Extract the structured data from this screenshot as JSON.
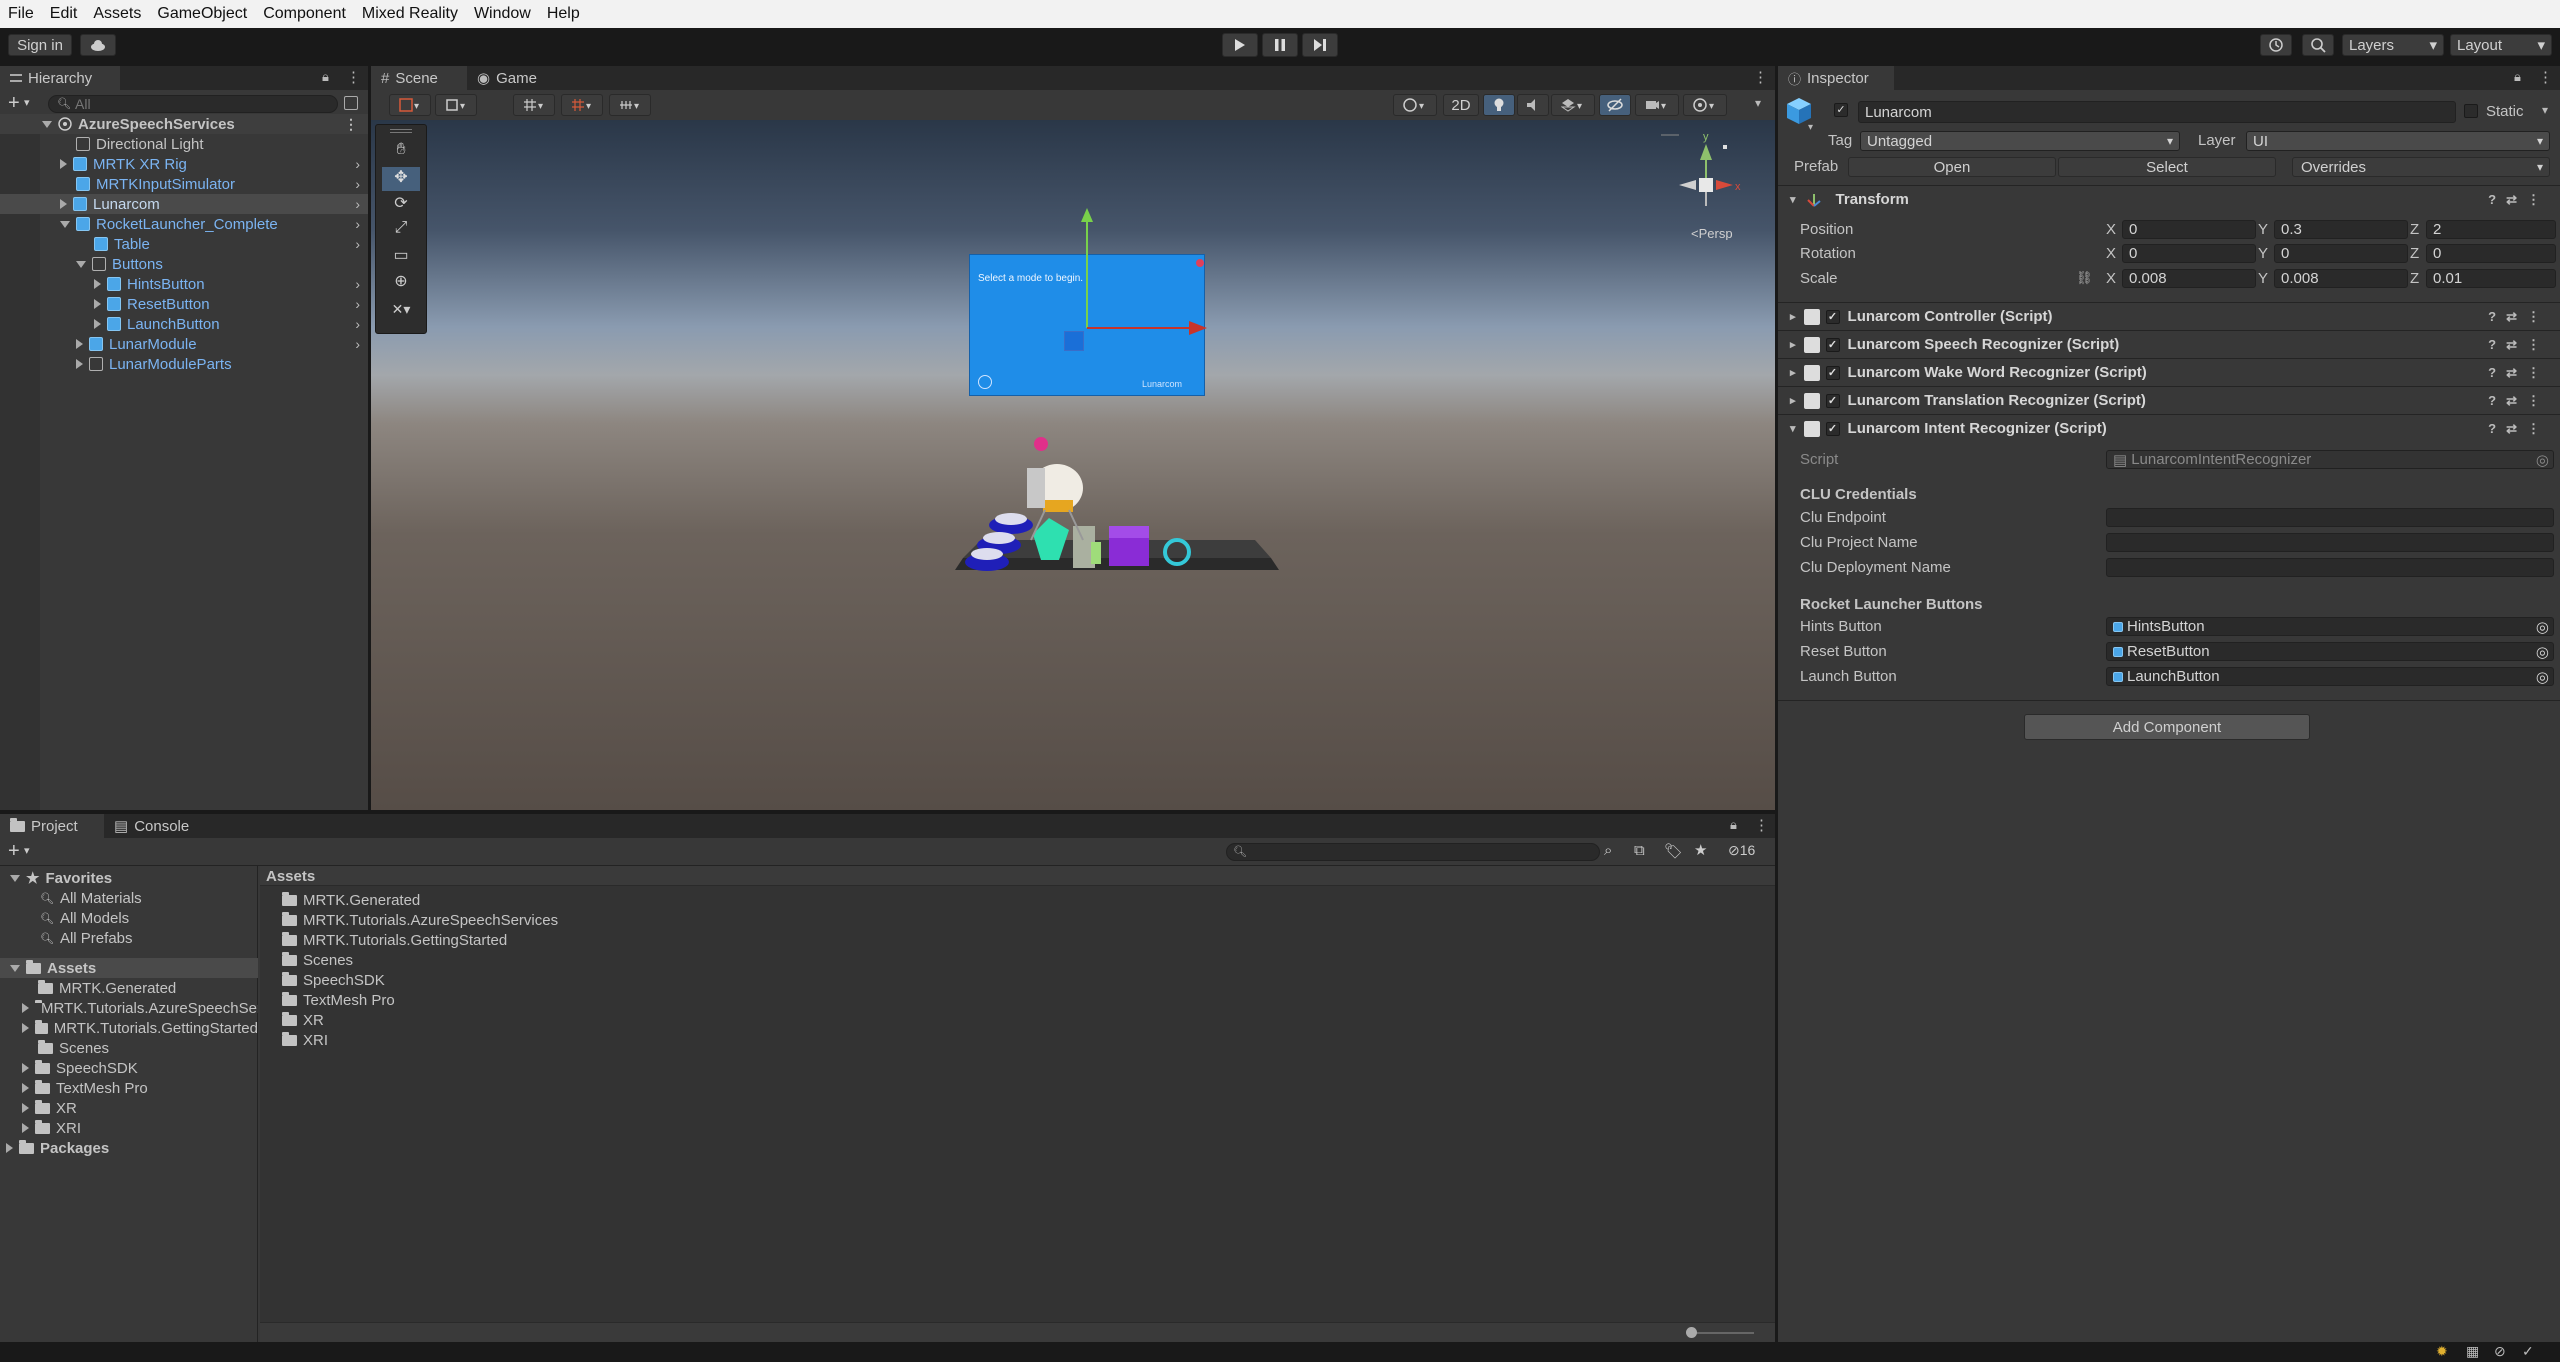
{
  "menu": [
    "File",
    "Edit",
    "Assets",
    "GameObject",
    "Component",
    "Mixed Reality",
    "Window",
    "Help"
  ],
  "toolbar": {
    "sign_in": "Sign in",
    "layers": "Layers",
    "layout": "Layout"
  },
  "hierarchy": {
    "tab": "Hierarchy",
    "search_placeholder": "All",
    "items": [
      {
        "label": "AzureSpeechServices"
      },
      {
        "label": "Directional Light"
      },
      {
        "label": "MRTK XR Rig"
      },
      {
        "label": "MRTKInputSimulator"
      },
      {
        "label": "Lunarcom"
      },
      {
        "label": "RocketLauncher_Complete"
      },
      {
        "label": "Table"
      },
      {
        "label": "Buttons"
      },
      {
        "label": "HintsButton"
      },
      {
        "label": "ResetButton"
      },
      {
        "label": "LaunchButton"
      },
      {
        "label": "LunarModule"
      },
      {
        "label": "LunarModuleParts"
      }
    ]
  },
  "scene": {
    "tab_scene": "Scene",
    "tab_game": "Game",
    "btn_2d": "2D",
    "persp": "<Persp",
    "panel_text": "Select a mode to begin.",
    "panel_brand": "Lunarcom"
  },
  "inspector": {
    "tab": "Inspector",
    "name": "Lunarcom",
    "static": "Static",
    "tag_label": "Tag",
    "tag": "Untagged",
    "layer_label": "Layer",
    "layer": "UI",
    "prefab_label": "Prefab",
    "open": "Open",
    "select": "Select",
    "overrides": "Overrides",
    "transform": {
      "title": "Transform",
      "position_label": "Position",
      "rotation_label": "Rotation",
      "scale_label": "Scale",
      "axis_x": "X",
      "axis_y": "Y",
      "axis_z": "Z",
      "position": [
        "0",
        "0.3",
        "2"
      ],
      "rotation": [
        "0",
        "0",
        "0"
      ],
      "scale": [
        "0.008",
        "0.008",
        "0.01"
      ]
    },
    "components": [
      "Lunarcom Controller (Script)",
      "Lunarcom Speech Recognizer (Script)",
      "Lunarcom Wake Word Recognizer (Script)",
      "Lunarcom Translation Recognizer (Script)",
      "Lunarcom Intent Recognizer (Script)"
    ],
    "script_label": "Script",
    "script_value": "LunarcomIntentRecognizer",
    "clu_header": "CLU Credentials",
    "clu_endpoint": "Clu Endpoint",
    "clu_project": "Clu Project Name",
    "clu_deployment": "Clu Deployment Name",
    "rl_header": "Rocket Launcher Buttons",
    "hints_label": "Hints Button",
    "hints_value": "HintsButton",
    "reset_label": "Reset Button",
    "reset_value": "ResetButton",
    "launch_label": "Launch Button",
    "launch_value": "LaunchButton",
    "add_component": "Add Component"
  },
  "project": {
    "tab_project": "Project",
    "tab_console": "Console",
    "hidden_count": "16",
    "favorites": "Favorites",
    "fav_items": [
      "All Materials",
      "All Models",
      "All Prefabs"
    ],
    "assets_root": "Assets",
    "tree_items": [
      "MRTK.Generated",
      "MRTK.Tutorials.AzureSpeechServices",
      "MRTK.Tutorials.GettingStarted",
      "Scenes",
      "SpeechSDK",
      "TextMesh Pro",
      "XR",
      "XRI"
    ],
    "packages": "Packages",
    "breadcrumb": "Assets",
    "grid_items": [
      "MRTK.Generated",
      "MRTK.Tutorials.AzureSpeechServices",
      "MRTK.Tutorials.GettingStarted",
      "Scenes",
      "SpeechSDK",
      "TextMesh Pro",
      "XR",
      "XRI"
    ]
  }
}
